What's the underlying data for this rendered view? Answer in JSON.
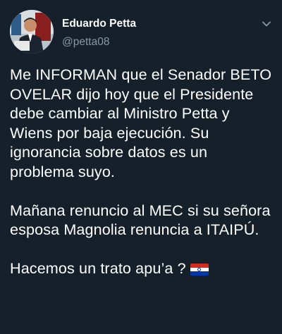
{
  "tweet": {
    "author": {
      "display_name": "Eduardo Petta",
      "handle": "@petta08"
    },
    "icons": {
      "menu": "chevron-down-icon",
      "flag": "paraguay-flag-icon"
    },
    "colors": {
      "background": "#15202b",
      "text": "#ffffff",
      "secondary_text": "#8899a6",
      "flag_red": "#d52b1e",
      "flag_white": "#ffffff",
      "flag_blue": "#0038a8"
    },
    "text_paragraphs": [
      "Me INFORMAN que el Senador BETO OVELAR dijo hoy que el Presidente debe cambiar al Ministro Petta y Wiens por baja ejecución. Su ignorancia sobre datos es un problema suyo.",
      "Mañana renuncio al MEC si su señora esposa Magnolia renuncia a ITAIPÚ.",
      "Hacemos un trato apu’a ?"
    ]
  }
}
